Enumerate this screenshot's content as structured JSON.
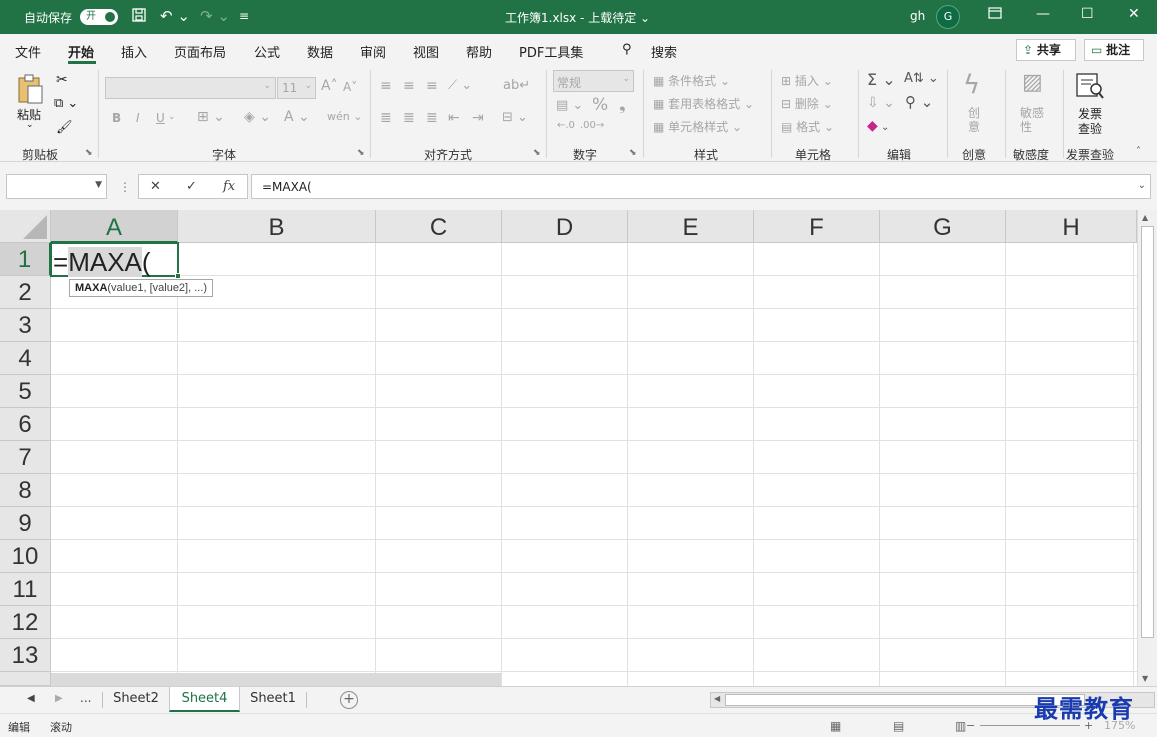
{
  "titlebar": {
    "autosave_label": "自动保存",
    "autosave_state": "开",
    "doc_title": "工作簿1.xlsx - 上载待定 ⌄",
    "user_name": "gh",
    "avatar_initial": "G",
    "undo_icon": "undo-icon",
    "redo_icon": "redo-icon"
  },
  "menu": {
    "tabs": [
      "文件",
      "开始",
      "插入",
      "页面布局",
      "公式",
      "数据",
      "审阅",
      "视图",
      "帮助",
      "PDF工具集"
    ],
    "search_label": "搜索",
    "share_label": "共享",
    "comment_label": "批注"
  },
  "ribbon": {
    "clipboard": {
      "paste_label": "粘贴",
      "group_label": "剪贴板"
    },
    "font": {
      "font_name": "",
      "font_size": "11",
      "bold": "B",
      "italic": "I",
      "underline": "U",
      "group_label": "字体"
    },
    "alignment": {
      "group_label": "对齐方式"
    },
    "number": {
      "format": "常规",
      "group_label": "数字"
    },
    "styles": {
      "conditional": "条件格式",
      "table_format": "套用表格格式",
      "cell_style": "单元格样式",
      "group_label": "样式"
    },
    "cells": {
      "insert": "插入",
      "delete": "删除",
      "format": "格式",
      "group_label": "单元格"
    },
    "editing": {
      "group_label": "编辑"
    },
    "creative": {
      "button": "创意",
      "group_label": "创意"
    },
    "sensitivity": {
      "button": "敏感性",
      "group_label": "敏感度"
    },
    "invoice": {
      "button_line1": "发票",
      "button_line2": "查验",
      "group_label": "发票查验"
    }
  },
  "formula_bar": {
    "name_box": "",
    "cancel": "✕",
    "enter": "✓",
    "fx": "fx",
    "formula": "=MAXA("
  },
  "grid": {
    "columns": [
      "A",
      "B",
      "C",
      "D",
      "E",
      "F",
      "G",
      "H"
    ],
    "rows": [
      "1",
      "2",
      "3",
      "4",
      "5",
      "6",
      "7",
      "8",
      "9",
      "10",
      "11",
      "12",
      "13"
    ],
    "active_cell_prefix": "=",
    "active_cell_func": "MAXA",
    "active_cell_suffix": "(",
    "tooltip_func": "MAXA",
    "tooltip_args": "(value1, [value2], ...)"
  },
  "sheets": {
    "more": "...",
    "tabs": [
      "Sheet2",
      "Sheet4",
      "Sheet1"
    ],
    "active_index": 1
  },
  "status": {
    "mode": "编辑",
    "scroll": "滚动",
    "zoom": "175%"
  },
  "watermark": "最需教育",
  "colors": {
    "accent": "#217346"
  }
}
